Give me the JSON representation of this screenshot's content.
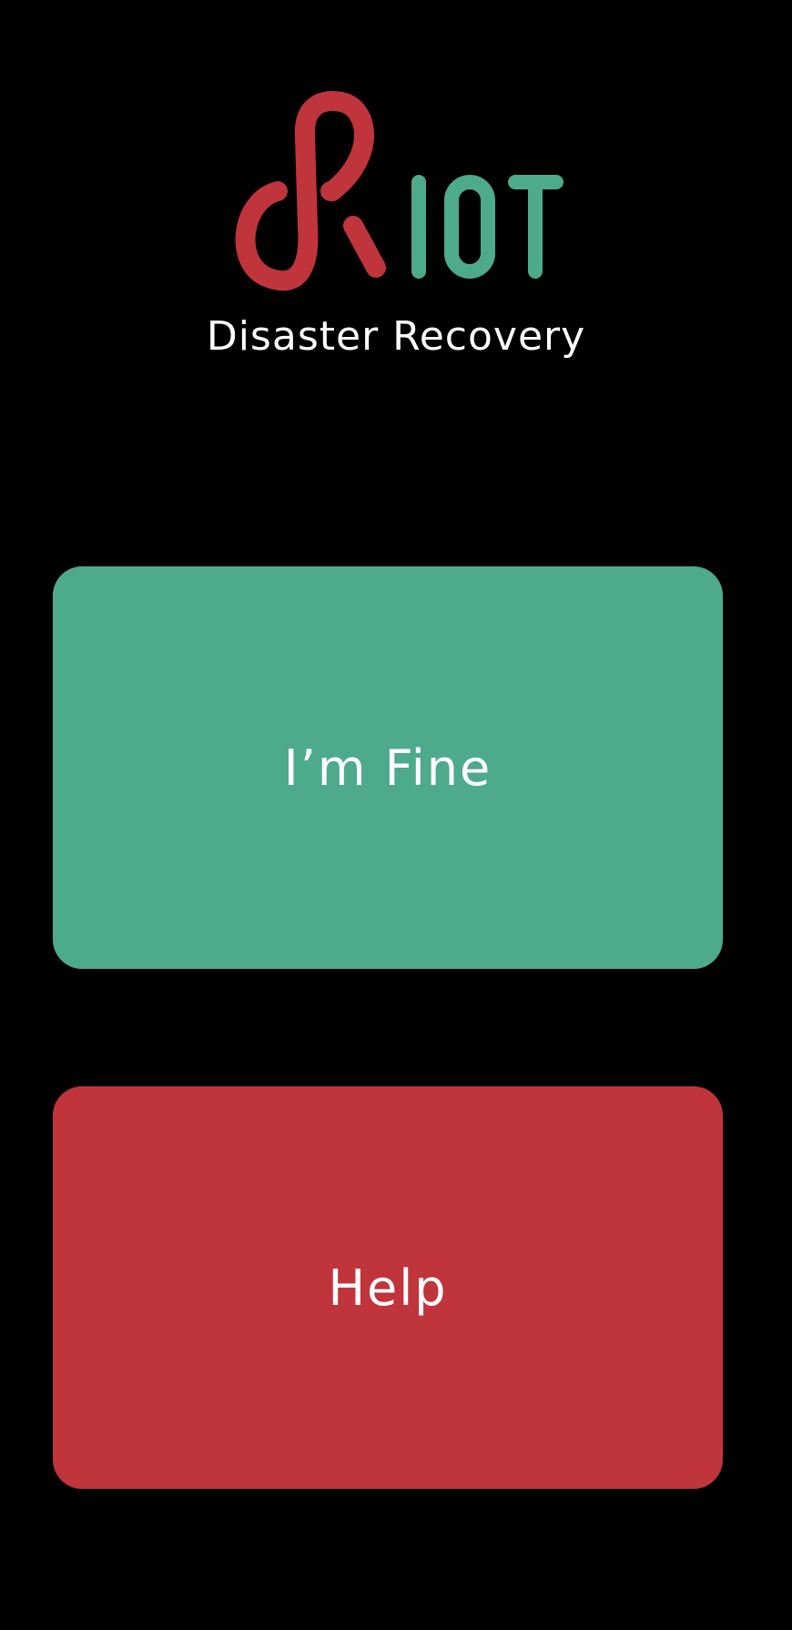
{
  "app": {
    "logo_text": "RIOT",
    "subtitle": "Disaster Recovery"
  },
  "actions": {
    "fine_label": "I’m Fine",
    "help_label": "Help"
  },
  "colors": {
    "background": "#000000",
    "brand_red": "#c0343c",
    "brand_green": "#4eaa8c",
    "text": "#ffffff"
  }
}
